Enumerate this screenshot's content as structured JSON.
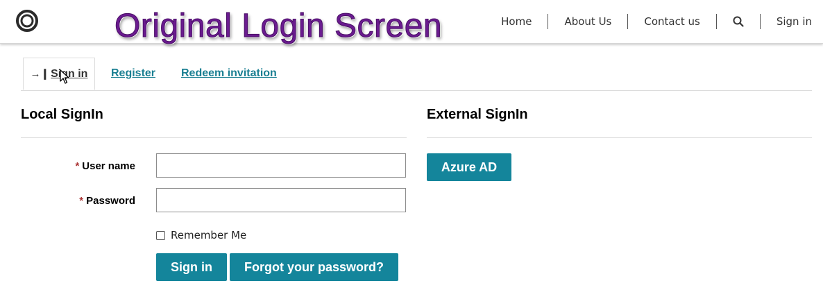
{
  "overlay_title": "Original Login Screen",
  "nav": {
    "home": "Home",
    "about": "About Us",
    "contact": "Contact us",
    "signin": "Sign in"
  },
  "tabs": {
    "signin": "Sign in",
    "register": "Register",
    "redeem": "Redeem invitation"
  },
  "local": {
    "title": "Local SignIn",
    "username_label": "User name",
    "password_label": "Password",
    "required_marker": "*",
    "username_value": "",
    "password_value": "",
    "remember_label": "Remember Me",
    "remember_checked": false,
    "signin_button": "Sign in",
    "forgot_button": "Forgot your password?"
  },
  "external": {
    "title": "External SignIn",
    "azure_button": "Azure AD"
  },
  "colors": {
    "accent": "#14859b",
    "link": "#1a7f92",
    "overlay_title": "#6a1b8f",
    "required": "#aa3333"
  },
  "icons": {
    "logo": "circle-logo-icon",
    "search": "search-icon",
    "signin_tab": "sign-in-arrow-icon",
    "cursor": "mouse-pointer-icon"
  }
}
